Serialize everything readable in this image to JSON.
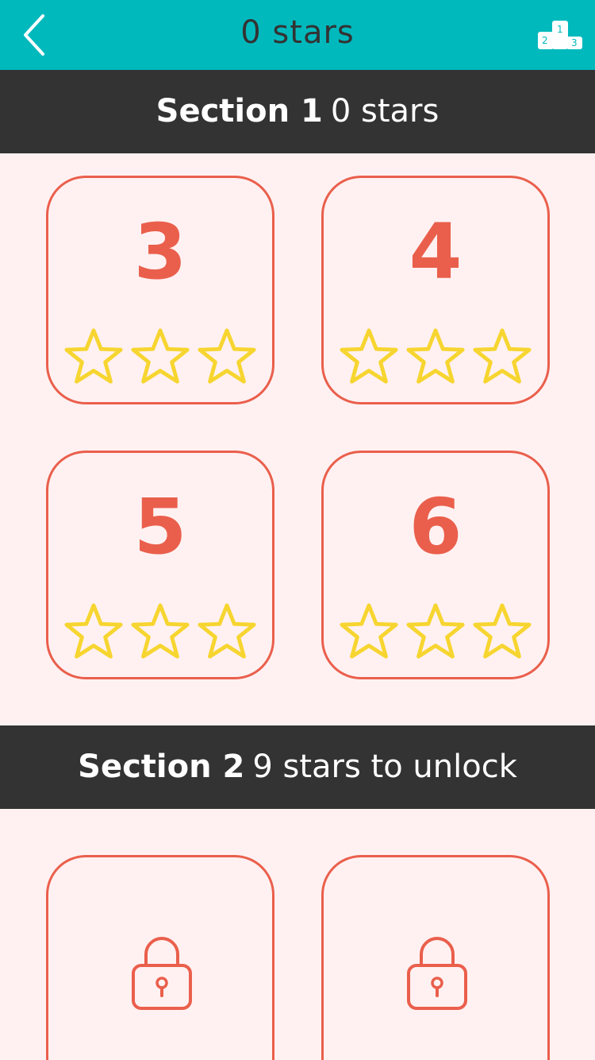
{
  "header": {
    "title": "0 stars",
    "back_icon": "chevron-left-icon",
    "leaderboard_icon": "podium-icon",
    "podium_labels": [
      "1",
      "2",
      "3"
    ],
    "background_color": "#00b9bd"
  },
  "sections": [
    {
      "name": "Section 1",
      "subtitle": "0 stars",
      "levels": [
        {
          "number": "3",
          "stars_earned": 0,
          "stars_total": 3
        },
        {
          "number": "4",
          "stars_earned": 0,
          "stars_total": 3
        },
        {
          "number": "5",
          "stars_earned": 0,
          "stars_total": 3
        },
        {
          "number": "6",
          "stars_earned": 0,
          "stars_total": 3
        }
      ]
    },
    {
      "name": "Section 2",
      "subtitle": "9 stars to unlock",
      "locked_tiles": 2,
      "lock_icon": "padlock-icon"
    }
  ],
  "colors": {
    "accent": "#ea5f4c",
    "star": "#f7d530",
    "section_bar": "#333333",
    "page_background": "#fff1f1"
  }
}
